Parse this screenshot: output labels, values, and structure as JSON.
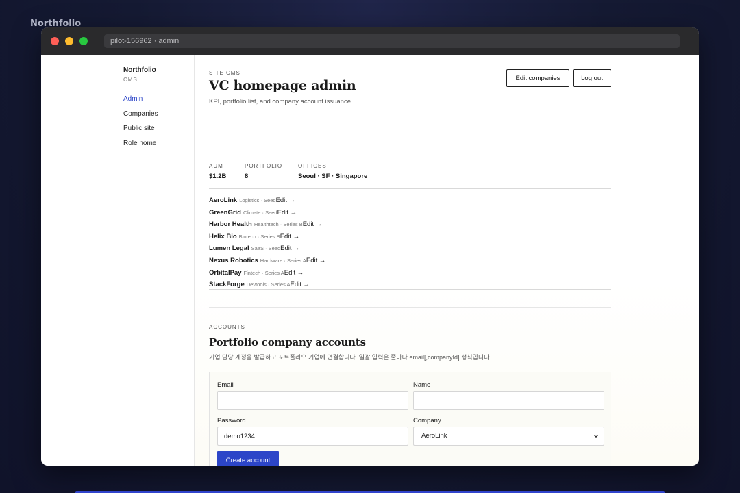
{
  "desktop": {
    "label": "Northfolio"
  },
  "window": {
    "url": "pilot-156962 · admin"
  },
  "sidebar": {
    "brand": "Northfolio",
    "brand_sub": "CMS",
    "items": [
      {
        "label": "Admin",
        "active": true
      },
      {
        "label": "Companies",
        "active": false
      },
      {
        "label": "Public site",
        "active": false
      },
      {
        "label": "Role home",
        "active": false
      }
    ]
  },
  "header": {
    "eyebrow": "SITE CMS",
    "title": "VC homepage admin",
    "subtitle": "KPI, portfolio list, and company account issuance.",
    "edit_companies_label": "Edit companies",
    "logout_label": "Log out"
  },
  "stats": [
    {
      "label": "AUM",
      "value": "$1.2B"
    },
    {
      "label": "PORTFOLIO",
      "value": "8"
    },
    {
      "label": "OFFICES",
      "value": "Seoul · SF · Singapore"
    }
  ],
  "portfolio": [
    {
      "name": "AeroLink",
      "meta": "Logistics · Seed",
      "edit": "Edit →"
    },
    {
      "name": "GreenGrid",
      "meta": "Climate · Seed",
      "edit": "Edit →"
    },
    {
      "name": "Harbor Health",
      "meta": "Healthtech · Series B",
      "edit": "Edit →"
    },
    {
      "name": "Helix Bio",
      "meta": "Biotech · Series B",
      "edit": "Edit →"
    },
    {
      "name": "Lumen Legal",
      "meta": "SaaS · Seed",
      "edit": "Edit →"
    },
    {
      "name": "Nexus Robotics",
      "meta": "Hardware · Series A",
      "edit": "Edit →"
    },
    {
      "name": "OrbitalPay",
      "meta": "Fintech · Series A",
      "edit": "Edit →"
    },
    {
      "name": "StackForge",
      "meta": "Devtools · Series A",
      "edit": "Edit →"
    }
  ],
  "accounts": {
    "eyebrow": "ACCOUNTS",
    "title": "Portfolio company accounts",
    "description": "기업 담당 계정을 발급하고 포트폴리오 기업에 연결합니다. 일괄 입력은 줄마다 email[,companyId] 형식입니다.",
    "form": {
      "email_label": "Email",
      "email_value": "",
      "name_label": "Name",
      "name_value": "",
      "password_label": "Password",
      "password_value": "demo1234",
      "company_label": "Company",
      "company_value": "AeroLink",
      "submit_label": "Create account"
    }
  }
}
